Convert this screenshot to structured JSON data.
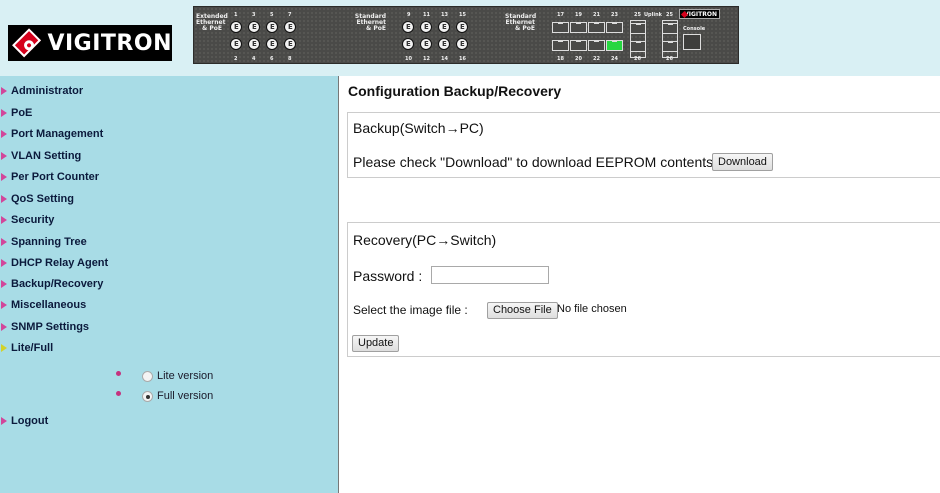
{
  "header": {
    "logo_text": "VIGITRON",
    "panel": {
      "label_extended": [
        "Extended",
        "Ethernet",
        "& PoE"
      ],
      "label_standard_left": [
        "Standard",
        "Ethernet",
        "& PoE"
      ],
      "label_standard_right": [
        "Standard",
        "Ethernet",
        "& PoE"
      ],
      "top_nums_1": [
        "1",
        "3",
        "5",
        "7"
      ],
      "bottom_nums_1": [
        "2",
        "4",
        "6",
        "8"
      ],
      "top_nums_2": [
        "9",
        "11",
        "13",
        "15"
      ],
      "bottom_nums_2": [
        "10",
        "12",
        "14",
        "16"
      ],
      "top_nums_3": [
        "17",
        "19",
        "21",
        "23"
      ],
      "bottom_nums_3": [
        "18",
        "20",
        "22",
        "24"
      ],
      "uplink_top": "25",
      "uplink_label": "Uplink",
      "uplink_top2": "25",
      "uplink_bottom": "26",
      "uplink_bottom2": "26",
      "console_label": "Console",
      "mini_logo": "VIGITRON"
    }
  },
  "sidebar": {
    "items": [
      {
        "label": "Administrator"
      },
      {
        "label": "PoE"
      },
      {
        "label": "Port Management"
      },
      {
        "label": "VLAN Setting"
      },
      {
        "label": "Per Port Counter"
      },
      {
        "label": "QoS Setting"
      },
      {
        "label": "Security"
      },
      {
        "label": "Spanning Tree"
      },
      {
        "label": "DHCP Relay Agent"
      },
      {
        "label": "Backup/Recovery"
      },
      {
        "label": "Miscellaneous"
      },
      {
        "label": "SNMP Settings"
      },
      {
        "label": "Lite/Full"
      }
    ],
    "lite_option": "Lite version",
    "full_option": "Full version",
    "logout": "Logout"
  },
  "main": {
    "title": "Configuration Backup/Recovery",
    "backup": {
      "title": "Backup(Switch→PC)",
      "instruction": "Please check \"Download\" to download EEPROM contents.",
      "download_button": "Download"
    },
    "recovery": {
      "title": "Recovery(PC→Switch)",
      "password_label": "Password :",
      "password_value": "",
      "select_label": "Select the image file :",
      "choose_file_button": "Choose File",
      "no_file_text": "No file chosen",
      "update_button": "Update"
    }
  }
}
